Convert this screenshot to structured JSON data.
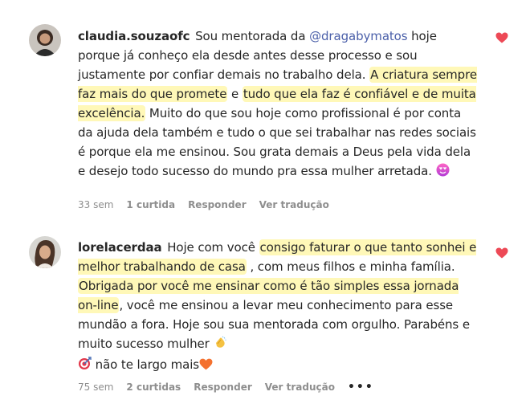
{
  "comments": [
    {
      "username": "claudia.souzaofc",
      "segments": {
        "t1": "Sou mentorada da ",
        "mention": "@dragabymatos",
        "t2": " hoje porque já conheço ela desde antes desse processo e sou justamente por confiar demais no trabalho dela. ",
        "h1": "A criatura sempre faz mais do que promete",
        "t3": " e ",
        "h2": "tudo que ela faz é confiável e de muita excelência.",
        "t4": " Muito do que sou hoje como profissional é por conta da ajuda dela também e tudo o que sei trabalhar nas redes sociais é porque ela me ensinou. Sou grata demais a Deus pela vida dela e desejo todo sucesso do mundo pra essa mulher arretada."
      },
      "emoji": "heart-eyes-icon",
      "time": "33 sem",
      "likes": "1 curtida",
      "reply": "Responder",
      "translate": "Ver tradução"
    },
    {
      "username": "lorelacerdaa",
      "segments": {
        "t1": "Hoje com você ",
        "h1": "consigo faturar o que tanto sonhei e melhor trabalhando de casa",
        "t2": " , com meus filhos e minha família. ",
        "h2": "Obrigada por você me ensinar como é tão simples essa jornada on-line",
        "t3": ", você me ensinou a levar meu conhecimento para esse mundão a fora. Hoje sou sua mentorada com orgulho. Parabéns e muito sucesso mulher",
        "t4": " não te largo mais"
      },
      "time": "75 sem",
      "likes": "2 curtidas",
      "reply": "Responder",
      "translate": "Ver tradução",
      "more": "•••"
    }
  ],
  "colors": {
    "heart": "#ed4956",
    "highlight": "#fff8b8",
    "mention": "#4a5fa9",
    "meta": "#8e8e8e"
  }
}
